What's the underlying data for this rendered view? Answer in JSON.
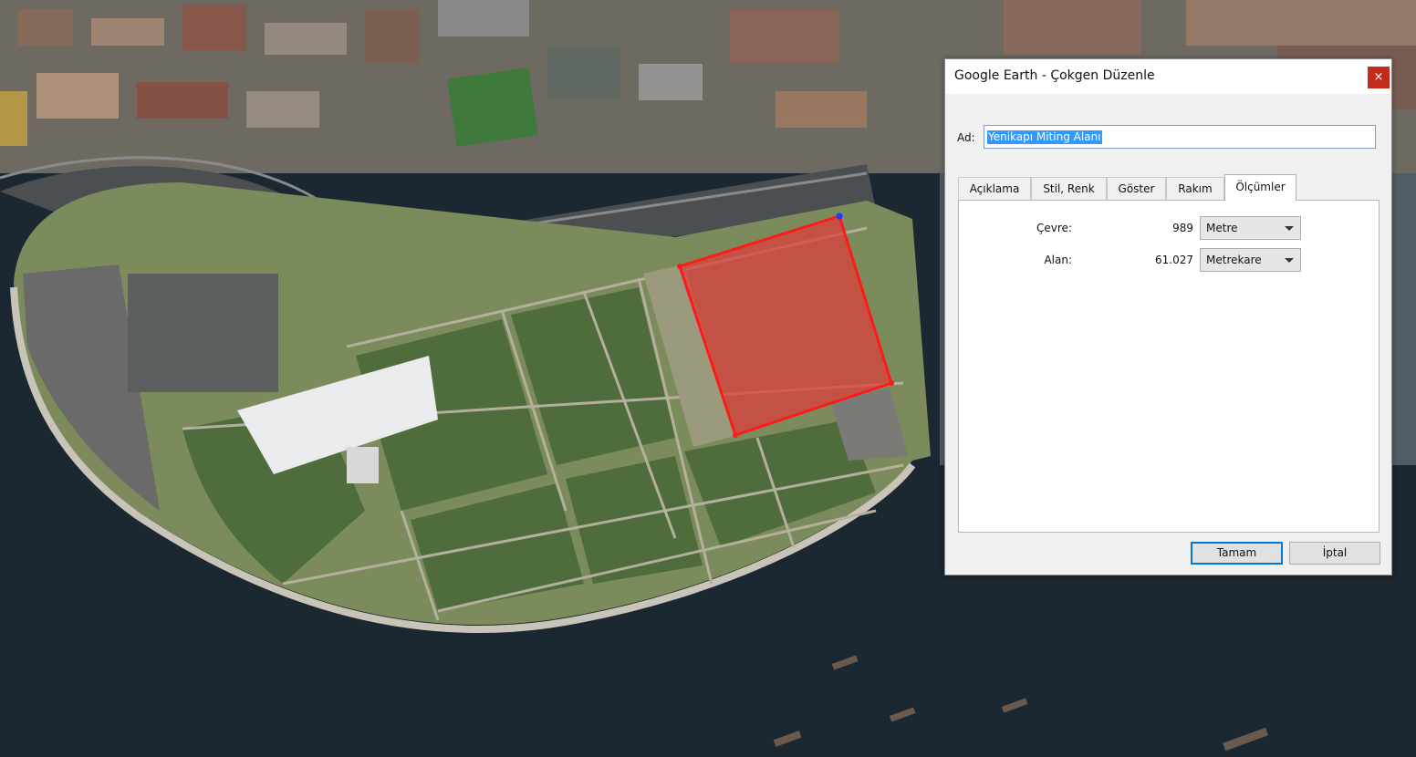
{
  "dialog": {
    "title": "Google Earth - Çokgen Düzenle",
    "close_glyph": "×",
    "name_label": "Ad:",
    "name_value": "Yenikapı Miting Alanı",
    "tabs": [
      {
        "label": "Açıklama"
      },
      {
        "label": "Stil, Renk"
      },
      {
        "label": "Göster"
      },
      {
        "label": "Rakım"
      },
      {
        "label": "Ölçümler",
        "active": true
      }
    ],
    "measurements": {
      "perimeter_label": "Çevre:",
      "perimeter_value": "989",
      "perimeter_unit": "Metre",
      "area_label": "Alan:",
      "area_value": "61.027",
      "area_unit": "Metrekare"
    },
    "ok_label": "Tamam",
    "cancel_label": "İptal"
  },
  "colors": {
    "polygon_fill": "#e03c3c",
    "polygon_stroke": "#ff1a1a",
    "sea": "#18232c",
    "accent": "#0078d7",
    "close_button": "#c42b1c"
  },
  "icons": {
    "close": "close-icon",
    "dropdown": "chevron-down-icon"
  }
}
